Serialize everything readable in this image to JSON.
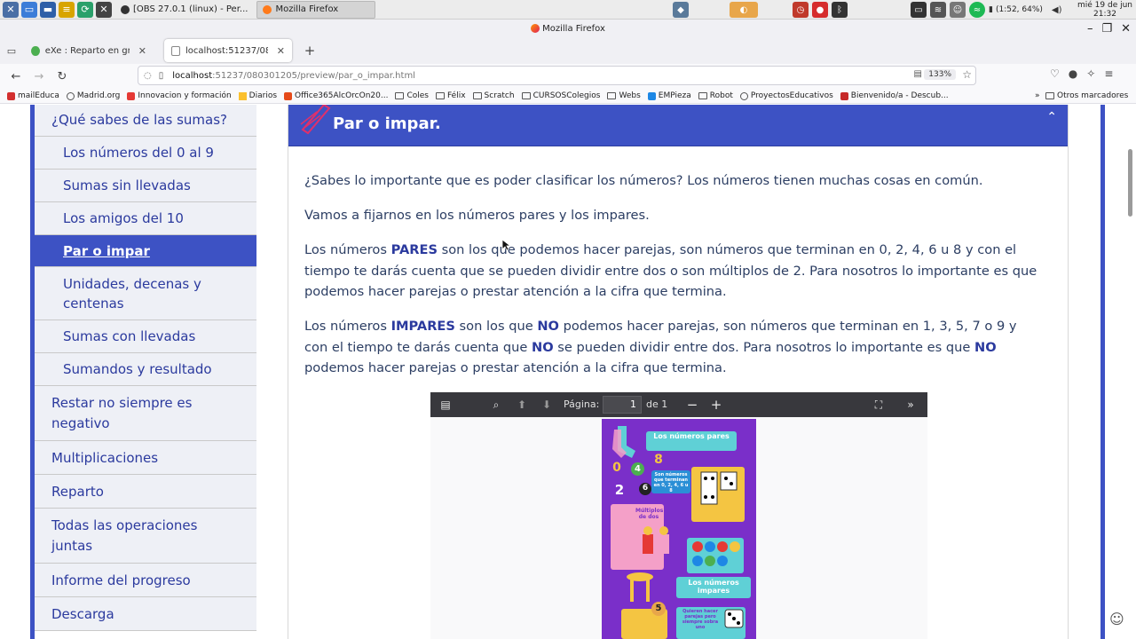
{
  "taskbar": {
    "tasks": [
      {
        "label": "[OBS 27.0.1 (linux) - Per..."
      },
      {
        "label": "Mozilla Firefox"
      }
    ],
    "battery": "(1:52, 64%)",
    "clock_line1": "mié 19 de jun",
    "clock_line2": "21:32"
  },
  "window": {
    "title": "Mozilla Firefox"
  },
  "tabs": [
    {
      "label": "eXe : Reparto en grupos"
    },
    {
      "label": "localhost:51237/080301"
    }
  ],
  "navbar": {
    "url_host": "localhost",
    "url_path": ":51237/080301205/preview/par_o_impar.html",
    "zoom": "133%"
  },
  "bookmarks": [
    {
      "label": "mailEduca"
    },
    {
      "label": "Madrid.org"
    },
    {
      "label": "Innovacion y formación"
    },
    {
      "label": "Diarios"
    },
    {
      "label": "Office365AlcOrcOn20..."
    },
    {
      "label": "Coles"
    },
    {
      "label": "Félix"
    },
    {
      "label": "Scratch"
    },
    {
      "label": "CURSOSColegios"
    },
    {
      "label": "Webs"
    },
    {
      "label": "EMPieza"
    },
    {
      "label": "Robot"
    },
    {
      "label": "ProyectosEducativos"
    },
    {
      "label": "Bienvenido/a - Descub..."
    },
    {
      "label": "Otros marcadores"
    }
  ],
  "sidebar": {
    "items": [
      {
        "label": "¿Qué sabes de las sumas?"
      },
      {
        "label": "Los números del 0 al 9"
      },
      {
        "label": "Sumas sin llevadas"
      },
      {
        "label": "Los amigos del 10"
      },
      {
        "label": "Par o impar"
      },
      {
        "label": "Unidades, decenas y centenas"
      },
      {
        "label": "Sumas con llevadas"
      },
      {
        "label": "Sumandos y resultado"
      },
      {
        "label": "Restar no siempre es negativo"
      },
      {
        "label": "Multiplicaciones"
      },
      {
        "label": "Reparto"
      },
      {
        "label": "Todas las operaciones juntas"
      },
      {
        "label": "Informe del progreso"
      },
      {
        "label": "Descarga"
      }
    ]
  },
  "content": {
    "title": "Par o impar.",
    "p1": "¿Sabes lo importante que es poder clasificar los números? Los números tienen muchas cosas en común.",
    "p2": "Vamos a fijarnos en los números pares y los impares.",
    "p3_a": "Los números ",
    "p3_b": "PARES",
    "p3_c": " son los que podemos hacer parejas, son números que terminan en 0, 2, 4, 6 u 8 y con el tiempo te darás cuenta que se pueden dividir entre dos o son múltiplos de 2. Para nosotros lo importante es que podemos hacer parejas o prestar atención a la cifra que termina.",
    "p4_a": "Los números ",
    "p4_b": "IMPARES",
    "p4_c": " son los que ",
    "p4_d": "NO",
    "p4_e": " podemos hacer parejas, son números que terminan en 1, 3, 5, 7 o 9 y con el tiempo te darás cuenta que ",
    "p4_f": "NO",
    "p4_g": " se pueden dividir entre dos. Para nosotros lo importante es que ",
    "p4_h": "NO",
    "p4_i": " podemos hacer parejas o prestar atención a la cifra que termina."
  },
  "pdf": {
    "page_label": "Página:",
    "page_value": "1",
    "page_total": "de 1",
    "poster": {
      "heading_pares": "Los números pares",
      "heading_impares": "Los números impares",
      "numbers": [
        "0",
        "4",
        "8",
        "2",
        "6",
        "5"
      ],
      "note_pares": "Son números que terminan en 0, 2, 4, 6 u 8",
      "note_multiplos": "Múltiplos de dos",
      "note_impares": "Quieren hacer parejas pero siempre sobra uno"
    }
  },
  "colors": {
    "brand": "#3d52c4",
    "sidebar_bg": "#eef0f6",
    "text": "#2c3e63",
    "poster_purple": "#7a2fc9"
  }
}
